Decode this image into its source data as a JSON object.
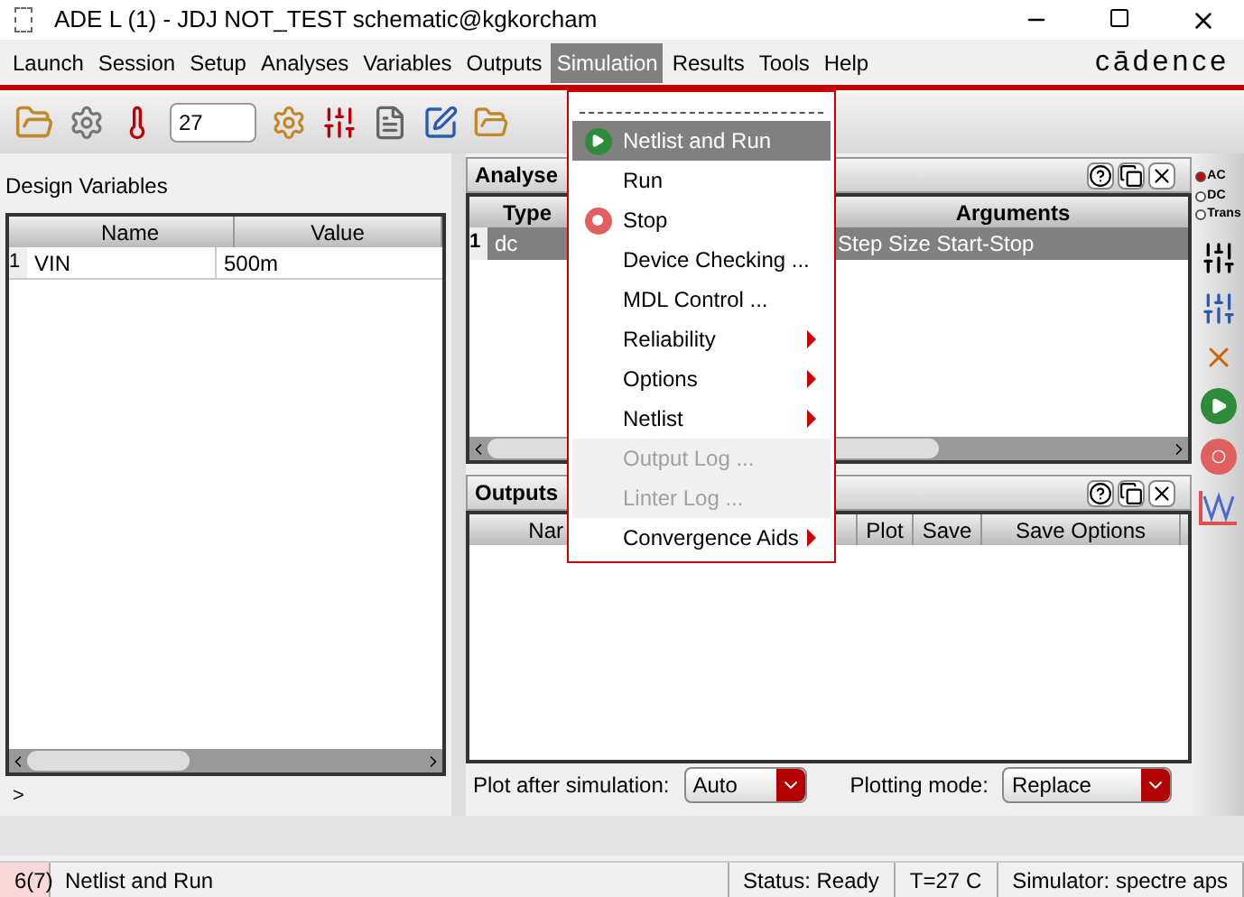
{
  "window": {
    "title": "ADE L (1) - JDJ NOT_TEST schematic@kgkorcham"
  },
  "menubar": [
    {
      "label": "Launch",
      "selected": false
    },
    {
      "label": "Session",
      "selected": false
    },
    {
      "label": "Setup",
      "selected": false
    },
    {
      "label": "Analyses",
      "selected": false
    },
    {
      "label": "Variables",
      "selected": false
    },
    {
      "label": "Outputs",
      "selected": false
    },
    {
      "label": "Simulation",
      "selected": true
    },
    {
      "label": "Results",
      "selected": false
    },
    {
      "label": "Tools",
      "selected": false
    },
    {
      "label": "Help",
      "selected": false
    }
  ],
  "brand": "cādence",
  "toolbar": {
    "temperature": "27"
  },
  "design_variables": {
    "title": "Design Variables",
    "columns": [
      "Name",
      "Value"
    ],
    "rows": [
      {
        "index": "1",
        "name": "VIN",
        "value": "500m"
      }
    ],
    "prompt": ">"
  },
  "analyses": {
    "title": "Analyse",
    "columns": [
      "Type",
      "Arguments"
    ],
    "rows": [
      {
        "index": "1",
        "type": "dc",
        "arguments": "Step Size Start-Stop",
        "selected": true
      }
    ]
  },
  "outputs": {
    "title": "Outputs",
    "columns": [
      "Nar",
      "Plot",
      "Save",
      "Save Options"
    ]
  },
  "plot_after_simulation": {
    "label": "Plot after simulation:",
    "value": "Auto"
  },
  "plotting_mode": {
    "label": "Plotting mode:",
    "value": "Replace"
  },
  "analysis_choice": [
    {
      "label": "AC",
      "selected": true
    },
    {
      "label": "DC",
      "selected": false
    },
    {
      "label": "Trans",
      "selected": false
    }
  ],
  "simulation_menu": [
    {
      "label": "Netlist and Run",
      "kind": "run",
      "selected": true,
      "disabled": false
    },
    {
      "label": "Run",
      "kind": "item",
      "selected": false,
      "disabled": false
    },
    {
      "label": "Stop",
      "kind": "stop",
      "selected": false,
      "disabled": false
    },
    {
      "label": "Device Checking ...",
      "kind": "item",
      "selected": false,
      "disabled": false
    },
    {
      "label": "MDL Control ...",
      "kind": "item",
      "selected": false,
      "disabled": false
    },
    {
      "label": "Reliability",
      "kind": "submenu",
      "selected": false,
      "disabled": false
    },
    {
      "label": "Options",
      "kind": "submenu",
      "selected": false,
      "disabled": false
    },
    {
      "label": "Netlist",
      "kind": "submenu",
      "selected": false,
      "disabled": false
    },
    {
      "label": "Output Log ...",
      "kind": "item",
      "selected": false,
      "disabled": true
    },
    {
      "label": "Linter Log ...",
      "kind": "item",
      "selected": false,
      "disabled": true
    },
    {
      "label": "Convergence Aids",
      "kind": "submenu",
      "selected": false,
      "disabled": false
    }
  ],
  "status_bar": [
    "6(7)",
    "Netlist and Run",
    "Status: Ready",
    "T=27 C",
    "Simulator: spectre aps"
  ]
}
